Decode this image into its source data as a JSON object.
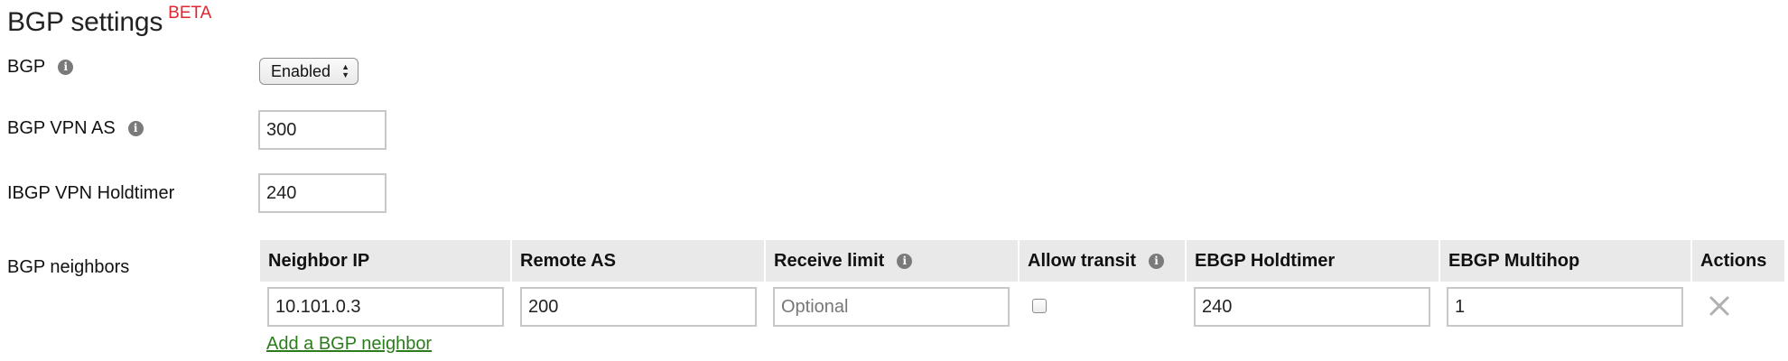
{
  "header": {
    "title": "BGP settings",
    "badge": "BETA",
    "badge_color": "#e0262f"
  },
  "bgp": {
    "label": "BGP",
    "info_icon": "info-icon",
    "selected_value": "Enabled"
  },
  "vpn_as": {
    "label": "BGP VPN AS",
    "info_icon": "info-icon",
    "value": "300"
  },
  "holdtimer": {
    "label": "IBGP VPN Holdtimer",
    "value": "240"
  },
  "neighbors": {
    "label": "BGP neighbors",
    "columns": [
      "Neighbor IP",
      "Remote AS",
      "Receive limit",
      "Allow transit",
      "EBGP Holdtimer",
      "EBGP Multihop",
      "Actions"
    ],
    "rows": [
      {
        "neighbor_ip": "10.101.0.3",
        "remote_as": "200",
        "receive_limit_placeholder": "Optional",
        "allow_transit": false,
        "ebgp_holdtimer": "240",
        "ebgp_multihop": "1",
        "action_icon": "close-icon"
      }
    ],
    "add_link": "Add a BGP neighbor",
    "link_color": "#2a7d1a"
  }
}
